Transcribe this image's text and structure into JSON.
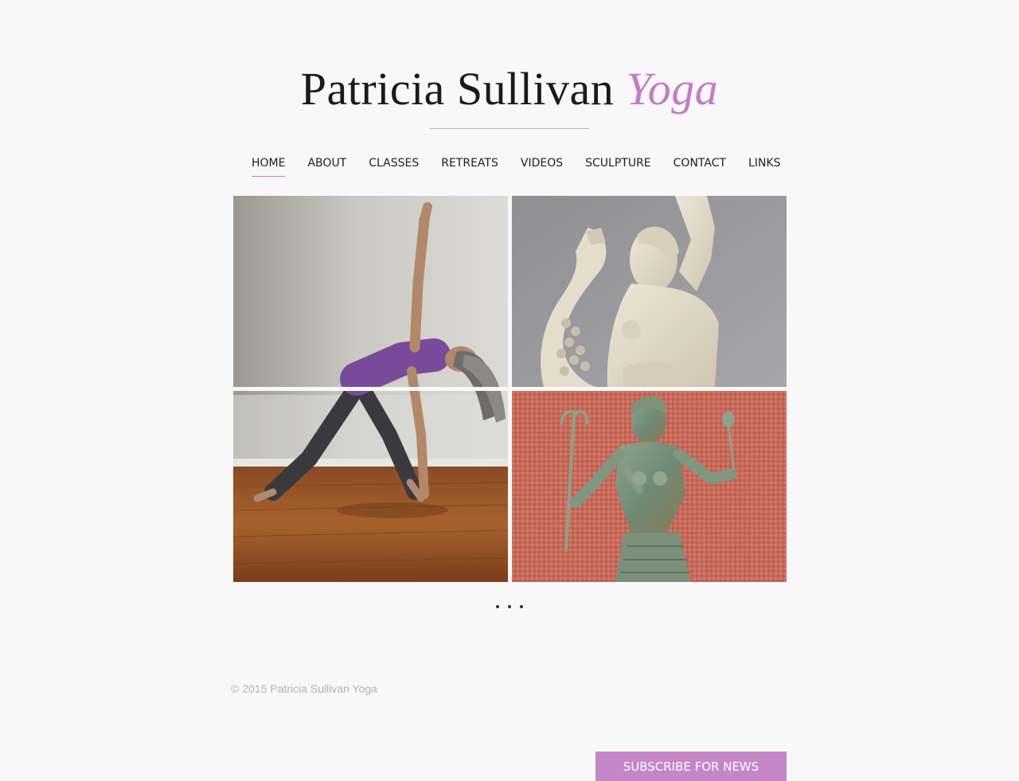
{
  "header": {
    "title_main": "Patricia Sullivan",
    "title_accent": "Yoga"
  },
  "nav": {
    "items": [
      {
        "label": "HOME",
        "active": true
      },
      {
        "label": "ABOUT"
      },
      {
        "label": "CLASSES"
      },
      {
        "label": "RETREATS"
      },
      {
        "label": "VIDEOS"
      },
      {
        "label": "SCULPTURE"
      },
      {
        "label": "CONTACT"
      },
      {
        "label": "LINKS"
      }
    ],
    "active_color": "#c37dc4"
  },
  "gallery": {
    "images": [
      {
        "name": "yoga-pose-photo"
      },
      {
        "name": "white-sculpture-photo"
      },
      {
        "name": "bronze-sculpture-photo"
      }
    ],
    "slide_count": 3
  },
  "footer": {
    "copyright": "© 2015 Patricia Sullivan Yoga",
    "subscribe_label": "SUBSCRIBE FOR NEWS",
    "subscribe_color": "#c586c7"
  }
}
